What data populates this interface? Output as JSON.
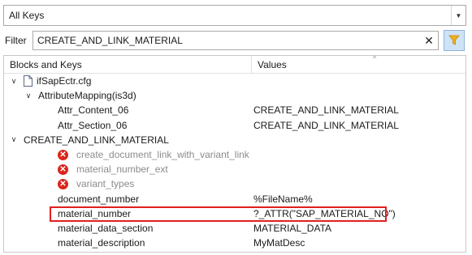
{
  "dropdown": {
    "selected": "All Keys"
  },
  "filter": {
    "label": "Filter",
    "value": "CREATE_AND_LINK_MATERIAL"
  },
  "tree": {
    "columns": {
      "keys": "Blocks and Keys",
      "values": "Values"
    },
    "file": "ifSapEctr.cfg",
    "block1": {
      "name": "AttributeMapping(is3d)",
      "rows": [
        {
          "key": "Attr_Content_06",
          "value": "CREATE_AND_LINK_MATERIAL"
        },
        {
          "key": "Attr_Section_06",
          "value": "CREATE_AND_LINK_MATERIAL"
        }
      ]
    },
    "block2": {
      "name": "CREATE_AND_LINK_MATERIAL",
      "missing": [
        "create_document_link_with_variant_link",
        "material_number_ext",
        "variant_types"
      ],
      "rows": [
        {
          "key": "document_number",
          "value": "%FileName%"
        },
        {
          "key": "material_number",
          "value": "?_ATTR(\"SAP_MATERIAL_NO\")"
        },
        {
          "key": "material_data_section",
          "value": "MATERIAL_DATA"
        },
        {
          "key": "material_description",
          "value": "MyMatDesc"
        }
      ]
    }
  },
  "colors": {
    "highlight": "#e02020",
    "error": "#d9261c",
    "filter_button": "#cfe3f7"
  }
}
